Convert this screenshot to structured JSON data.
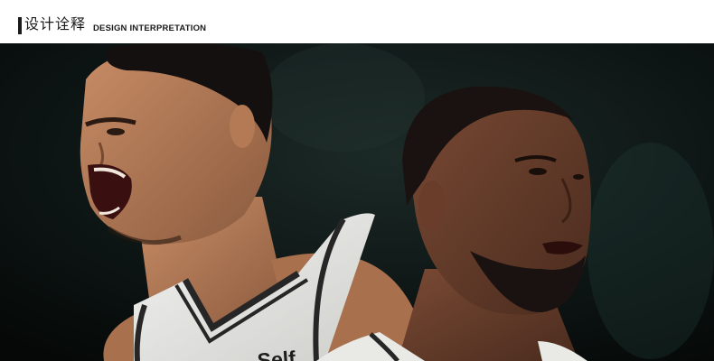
{
  "header": {
    "title_cn": "设计诠释",
    "title_en": "DESIGN INTERPRETATION"
  },
  "photo": {
    "jersey_sponsor": "Self."
  }
}
